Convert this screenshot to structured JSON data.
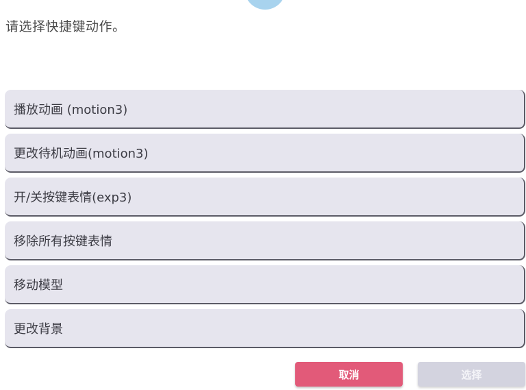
{
  "dialog": {
    "icon": "info-icon",
    "prompt": "请选择快捷键动作。",
    "options": [
      {
        "label": "播放动画 (motion3)"
      },
      {
        "label": "更改待机动画(motion3)"
      },
      {
        "label": "开/关按键表情(exp3)"
      },
      {
        "label": "移除所有按键表情"
      },
      {
        "label": "移动模型"
      },
      {
        "label": "更改背景"
      }
    ],
    "cancel_label": "取消",
    "select_label": "选择"
  },
  "colors": {
    "option_bg": "#e6e5ee",
    "cancel_bg": "#e25a79",
    "select_bg_disabled": "#d3d3df",
    "icon_bg": "#a8d3ee"
  }
}
